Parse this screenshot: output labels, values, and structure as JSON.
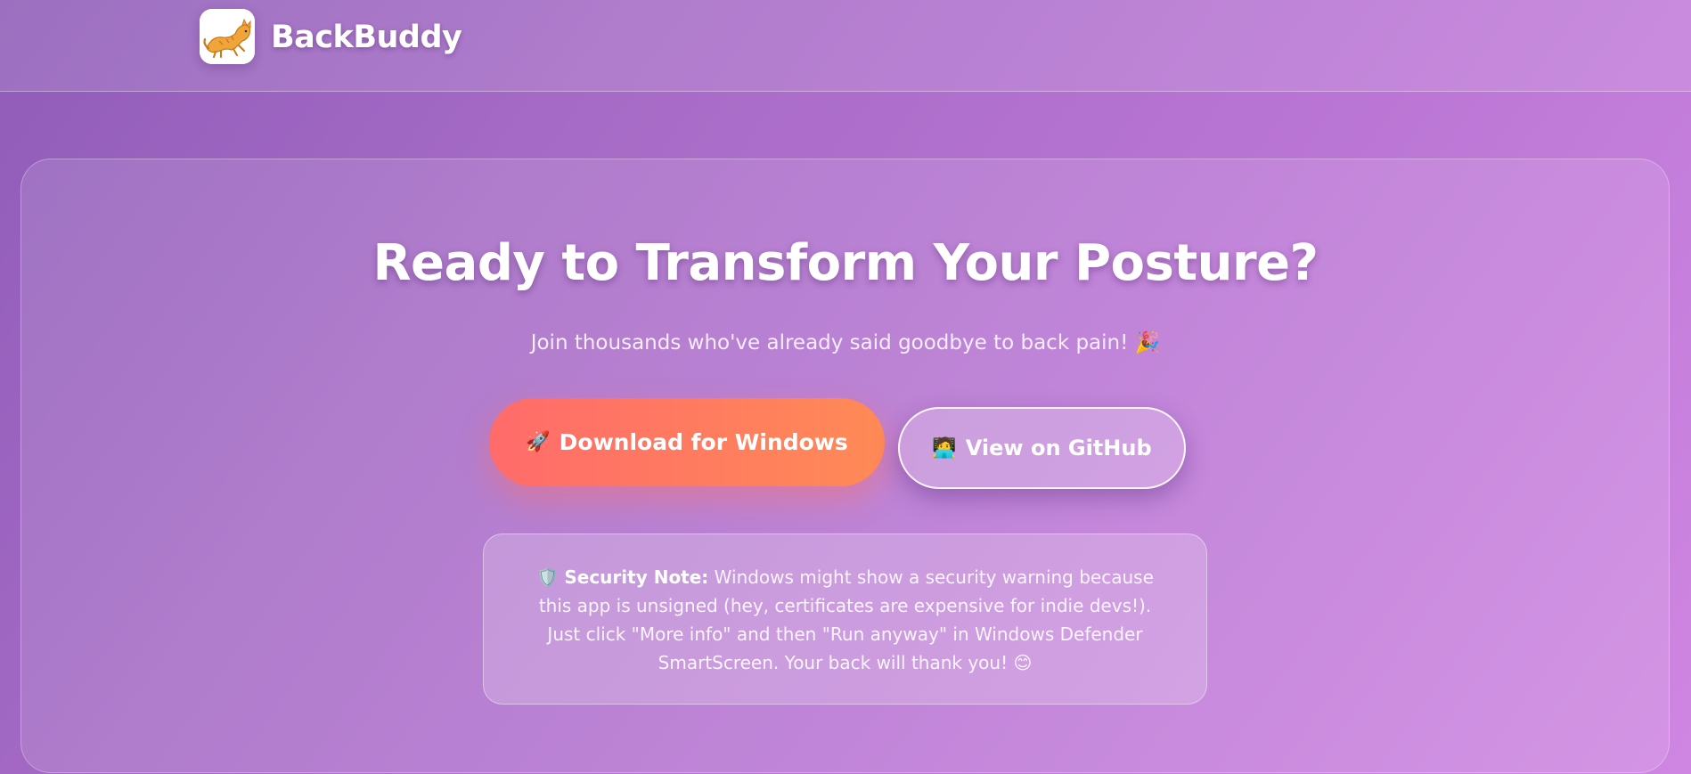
{
  "header": {
    "brand_name": "BackBuddy",
    "logo_icon": "stretching-cat-icon"
  },
  "hero": {
    "headline": "Ready to Transform Your Posture?",
    "subline": "Join thousands who've already said goodbye to back pain! 🎉",
    "download_button": {
      "icon": "🚀",
      "label": "Download for Windows"
    },
    "github_button": {
      "icon": "🧑‍💻",
      "label": "View on GitHub"
    },
    "security_note": {
      "icon": "🛡️",
      "label": "Security Note:",
      "text": "Windows might show a security warning because this app is unsigned (hey, certificates are expensive for indie devs!). Just click \"More info\" and then \"Run anyway\" in Windows Defender SmartScreen. Your back will thank you! 😊"
    }
  },
  "colors": {
    "background_start": "#8f5cb8",
    "background_end": "#cf86e2",
    "download_gradient_start": "#ff6b6b",
    "download_gradient_end": "#ff8a56"
  }
}
